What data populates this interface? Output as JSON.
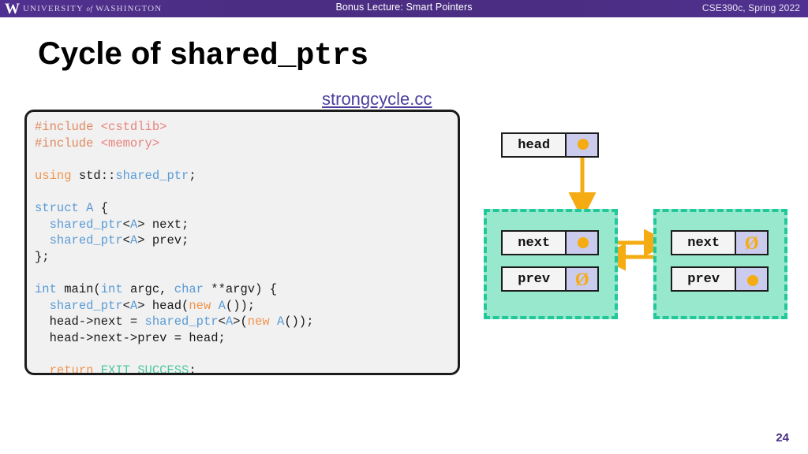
{
  "header": {
    "logo_w": "W",
    "wordmark_pre": "UNIVERSITY",
    "wordmark_of": "of",
    "wordmark_post": "WASHINGTON",
    "center_title": "Bonus Lecture: Smart Pointers",
    "course": "CSE390c, Spring 2022",
    "bar_color": "#4b2e83"
  },
  "title": {
    "text_plain": "Cycle of ",
    "text_mono": "shared_ptrs"
  },
  "file_link": {
    "label": "strongcycle.cc",
    "color": "#4b3f9e"
  },
  "code": {
    "lines": [
      [
        {
          "t": "#include ",
          "c": "cd-pre"
        },
        {
          "t": "<cstdlib>",
          "c": "cd-hdr"
        }
      ],
      [
        {
          "t": "#include ",
          "c": "cd-pre"
        },
        {
          "t": "<memory>",
          "c": "cd-hdr"
        }
      ],
      [],
      [
        {
          "t": "using ",
          "c": "cd-kw"
        },
        {
          "t": "std::",
          "c": "cd-plain"
        },
        {
          "t": "shared_ptr",
          "c": "cd-type"
        },
        {
          "t": ";",
          "c": "cd-plain"
        }
      ],
      [],
      [
        {
          "t": "struct ",
          "c": "cd-type"
        },
        {
          "t": "A",
          "c": "cd-type"
        },
        {
          "t": " {",
          "c": "cd-plain"
        }
      ],
      [
        {
          "t": "  ",
          "c": "cd-plain"
        },
        {
          "t": "shared_ptr",
          "c": "cd-type"
        },
        {
          "t": "<",
          "c": "cd-plain"
        },
        {
          "t": "A",
          "c": "cd-type"
        },
        {
          "t": "> next;",
          "c": "cd-plain"
        }
      ],
      [
        {
          "t": "  ",
          "c": "cd-plain"
        },
        {
          "t": "shared_ptr",
          "c": "cd-type"
        },
        {
          "t": "<",
          "c": "cd-plain"
        },
        {
          "t": "A",
          "c": "cd-type"
        },
        {
          "t": "> prev;",
          "c": "cd-plain"
        }
      ],
      [
        {
          "t": "};",
          "c": "cd-plain"
        }
      ],
      [],
      [
        {
          "t": "int ",
          "c": "cd-type"
        },
        {
          "t": "main(",
          "c": "cd-plain"
        },
        {
          "t": "int ",
          "c": "cd-type"
        },
        {
          "t": "argc, ",
          "c": "cd-plain"
        },
        {
          "t": "char ",
          "c": "cd-type"
        },
        {
          "t": "**argv) {",
          "c": "cd-plain"
        }
      ],
      [
        {
          "t": "  ",
          "c": "cd-plain"
        },
        {
          "t": "shared_ptr",
          "c": "cd-type"
        },
        {
          "t": "<",
          "c": "cd-plain"
        },
        {
          "t": "A",
          "c": "cd-type"
        },
        {
          "t": "> head(",
          "c": "cd-plain"
        },
        {
          "t": "new ",
          "c": "cd-kw"
        },
        {
          "t": "A",
          "c": "cd-type"
        },
        {
          "t": "());",
          "c": "cd-plain"
        }
      ],
      [
        {
          "t": "  head->next = ",
          "c": "cd-plain"
        },
        {
          "t": "shared_ptr",
          "c": "cd-type"
        },
        {
          "t": "<",
          "c": "cd-plain"
        },
        {
          "t": "A",
          "c": "cd-type"
        },
        {
          "t": ">(",
          "c": "cd-plain"
        },
        {
          "t": "new ",
          "c": "cd-kw"
        },
        {
          "t": "A",
          "c": "cd-type"
        },
        {
          "t": "());",
          "c": "cd-plain"
        }
      ],
      [
        {
          "t": "  head->next->prev = head;",
          "c": "cd-plain"
        }
      ],
      [],
      [
        {
          "t": "  ",
          "c": "cd-plain"
        },
        {
          "t": "return ",
          "c": "cd-kw"
        },
        {
          "t": "EXIT_SUCCESS",
          "c": "cd-const"
        },
        {
          "t": ";",
          "c": "cd-plain"
        }
      ],
      [
        {
          "t": "}",
          "c": "cd-plain"
        }
      ]
    ]
  },
  "diagram": {
    "stack_var": {
      "label": "head",
      "pointer": "non-null"
    },
    "left_node": {
      "fields": [
        {
          "label": "next",
          "pointer": "non-null"
        },
        {
          "label": "prev",
          "pointer": "null"
        }
      ]
    },
    "right_node": {
      "fields": [
        {
          "label": "next",
          "pointer": "null"
        },
        {
          "label": "prev",
          "pointer": "non-null"
        }
      ]
    },
    "null_symbol": "Ø",
    "arrow_color": "#f5ab12",
    "heap_fill": "#97e8cd",
    "heap_border": "#23c89a",
    "pointer_cell_color": "#cbcbee"
  },
  "footer": {
    "page_number": "24"
  }
}
